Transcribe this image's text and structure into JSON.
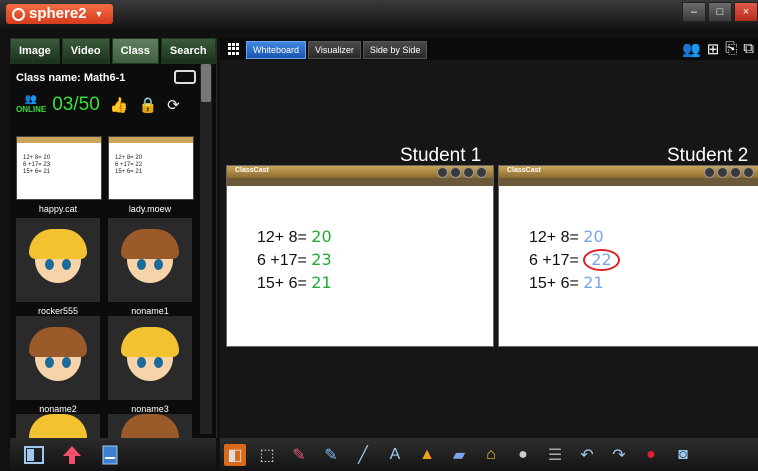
{
  "app": {
    "title": "sphere2"
  },
  "window": {
    "minimize": "–",
    "maximize": "□",
    "close": "×"
  },
  "leftpanel": {
    "tabs": [
      {
        "label": "Image"
      },
      {
        "label": "Video"
      },
      {
        "label": "Class"
      },
      {
        "label": "Search"
      }
    ],
    "active_tab": "Class",
    "class_name": "Class name: Math6-1",
    "online_label": "ONLINE",
    "online_count": "03/50",
    "students": [
      {
        "name": "happy.cat",
        "type": "thumb",
        "lines": [
          "12+ 8= 20",
          "6 +17= 23",
          "15+ 6= 21"
        ]
      },
      {
        "name": "lady.moew",
        "type": "thumb",
        "lines": [
          "12+ 8= 20",
          "6 +17= 22",
          "15+ 6= 21"
        ]
      },
      {
        "name": "rocker555",
        "type": "avatar",
        "hair": "#f2c230"
      },
      {
        "name": "noname1",
        "type": "avatar",
        "hair": "#9a5a2a"
      },
      {
        "name": "noname2",
        "type": "avatar",
        "hair": "#9a5a2a"
      },
      {
        "name": "noname3",
        "type": "avatar",
        "hair": "#f2c230"
      },
      {
        "name": "",
        "type": "avatar",
        "hair": "#f2c230"
      },
      {
        "name": "",
        "type": "avatar",
        "hair": "#9a5a2a"
      }
    ]
  },
  "modes": [
    {
      "label": "Whiteboard",
      "active": true
    },
    {
      "label": "Visualizer",
      "active": false
    },
    {
      "label": "Side by Side",
      "active": false
    }
  ],
  "compare": [
    {
      "label": "Student 1",
      "brand": "ClassCast",
      "q": [
        "12+ 8=",
        "6 +17=",
        "15+ 6="
      ],
      "a": [
        "20",
        "23",
        "21"
      ],
      "ans_color": "green"
    },
    {
      "label": "Student 2",
      "brand": "ClassCast",
      "q": [
        "12+ 8=",
        "6 +17=",
        "15+ 6="
      ],
      "a": [
        "20",
        "22",
        "21"
      ],
      "ans_color": "blue"
    }
  ],
  "colors": {
    "accent_orange": "#d86a1a",
    "tab_green": "#3f5f3f",
    "online_green": "#38e038"
  }
}
